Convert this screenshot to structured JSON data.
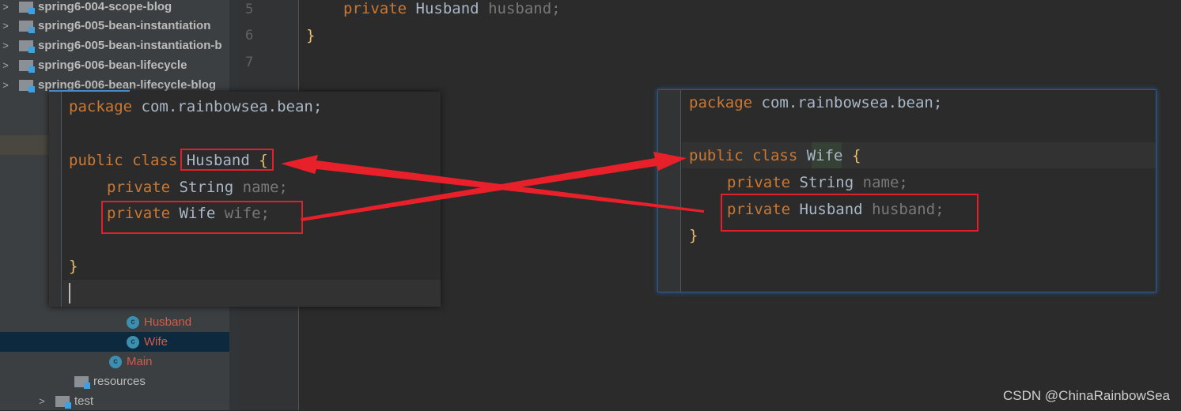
{
  "tree": [
    {
      "label": "spring6-004-scope-blog",
      "type": "module"
    },
    {
      "label": "spring6-005-bean-instantiation",
      "type": "module"
    },
    {
      "label": "spring6-005-bean-instantiation-b",
      "type": "module"
    },
    {
      "label": "spring6-006-bean-lifecycle",
      "type": "module"
    },
    {
      "label": "spring6-006-bean-lifecycle-blog",
      "type": "module"
    },
    {
      "label": "Husband",
      "type": "class"
    },
    {
      "label": "Wife",
      "type": "class",
      "selected": true
    },
    {
      "label": "Main",
      "type": "main-class"
    },
    {
      "label": "resources",
      "type": "resources-folder"
    },
    {
      "label": "test",
      "type": "folder"
    }
  ],
  "gutter": {
    "lines": [
      "5",
      "6",
      "7"
    ]
  },
  "editor": {
    "line5": {
      "kw": "private",
      "type": "Husband",
      "field": "husband;"
    },
    "line6": "}"
  },
  "left_popup": {
    "package_kw": "package",
    "package_name": "com.rainbowsea.bean;",
    "class_kw": "public class",
    "class_name": "Husband",
    "open": "{",
    "f1_kw": "private",
    "f1_type": "String",
    "f1_name": "name;",
    "f2_kw": "private",
    "f2_type": "Wife",
    "f2_name": "wife;",
    "close": "}"
  },
  "right_popup": {
    "package_kw": "package",
    "package_name": "com.rainbowsea.bean;",
    "class_kw": "public class",
    "class_name": "Wife",
    "open": "{",
    "f1_kw": "private",
    "f1_type": "String",
    "f1_name": "name;",
    "f2_kw": "private",
    "f2_type": "Husband",
    "f2_name": "husband;",
    "close": "}"
  },
  "annotation_color": "#e0202a",
  "watermark": "CSDN @ChinaRainbowSea"
}
